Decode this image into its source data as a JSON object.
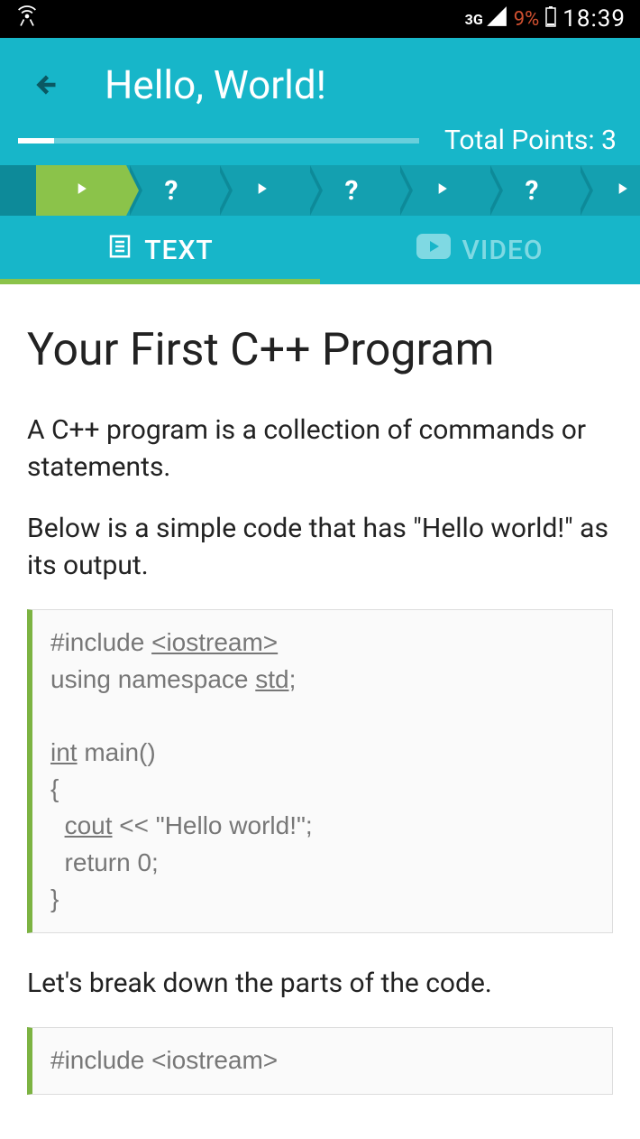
{
  "status": {
    "network": "3G",
    "battery": "9%",
    "time": "18:39"
  },
  "header": {
    "title": "Hello, World!",
    "points_label": "Total Points: 3"
  },
  "tabs": {
    "text": "TEXT",
    "video": "VIDEO"
  },
  "content": {
    "heading": "Your First C++ Program",
    "para1": "A C++ program is a collection of commands or statements.",
    "para2": "Below is a simple code that has \"Hello world!\" as its output.",
    "para3": "Let's break down the parts of the code.",
    "code1": {
      "l1a": "#include ",
      "l1b": "<iostream>",
      "l2a": "using namespace ",
      "l2b": "std;",
      "l3a": "int",
      "l3b": " main()",
      "l4": "{",
      "l5a": "  ",
      "l5b": "cout",
      "l5c": " << \"Hello world!\";",
      "l6": "  return 0;",
      "l7": "}"
    },
    "code2": "#include <iostream>"
  }
}
